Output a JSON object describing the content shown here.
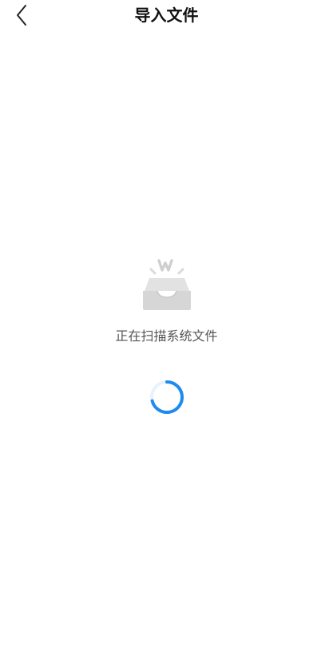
{
  "header": {
    "title": "导入文件",
    "back_icon": "chevron-left-icon"
  },
  "main": {
    "illustration_icon": "inbox-tray-icon",
    "status_text": "正在扫描系统文件",
    "loading_icon": "loading-spinner-icon"
  },
  "colors": {
    "spinner": "#1E8BF0",
    "illustration": "#DADADA",
    "title": "#111111",
    "status_text": "#555555"
  }
}
